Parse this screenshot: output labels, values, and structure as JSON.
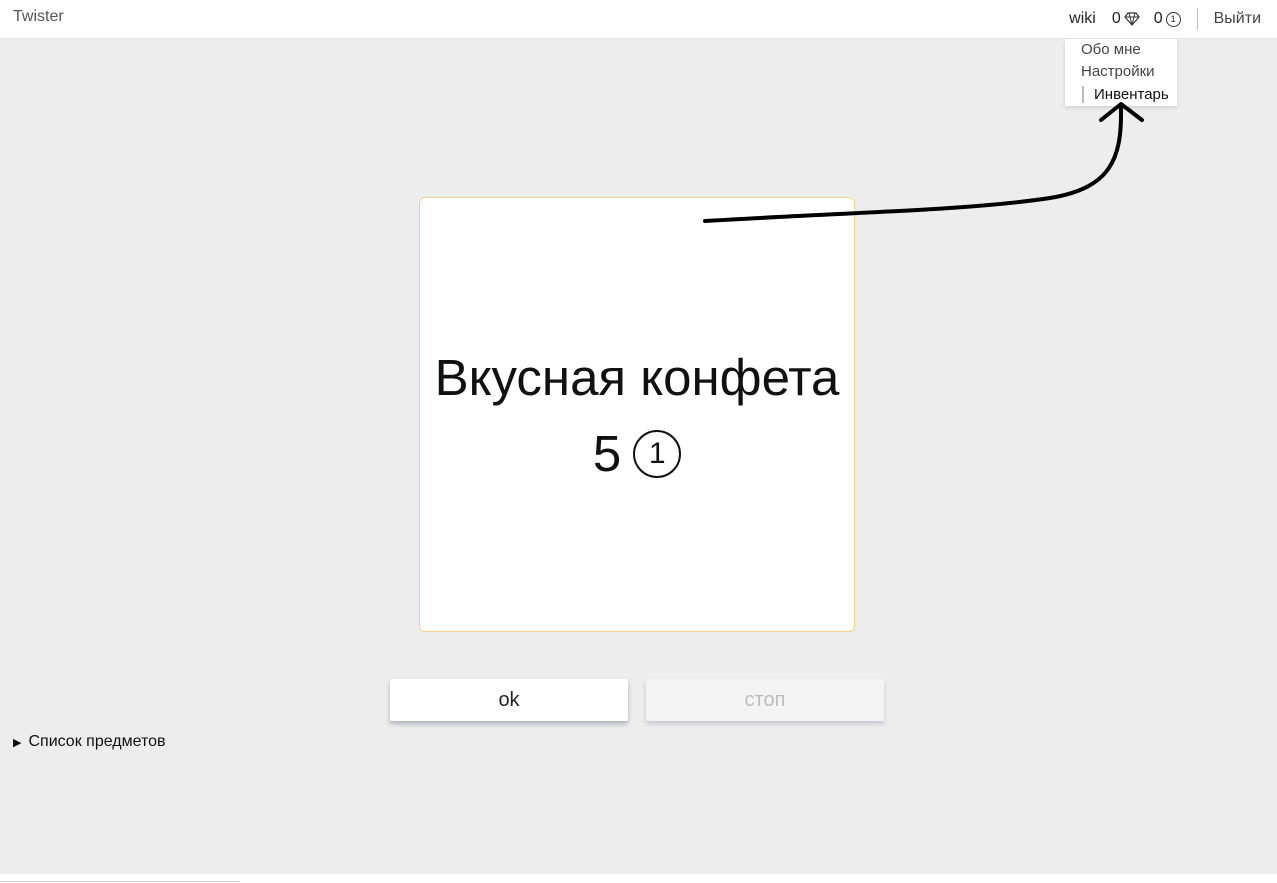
{
  "header": {
    "brand": "Twister",
    "wiki": "wiki",
    "gems_count": "0",
    "coins_count": "0",
    "coin_symbol": "1",
    "logout": "Выйти"
  },
  "dropdown": {
    "items": [
      "Обо мне",
      "Настройки",
      "Инвентарь"
    ]
  },
  "card": {
    "title": "Вкусная конфета",
    "price": "5",
    "coin_symbol": "1"
  },
  "buttons": {
    "ok": "ok",
    "stop": "стоп"
  },
  "details": {
    "summary": "Список предметов"
  },
  "icons": {
    "gem": "gem-icon",
    "coin": "coin-icon",
    "triangle": "triangle-right-icon",
    "arrow": "arrow-annotation"
  },
  "colors": {
    "card_border": "#f0d58a",
    "background": "#ededed"
  }
}
